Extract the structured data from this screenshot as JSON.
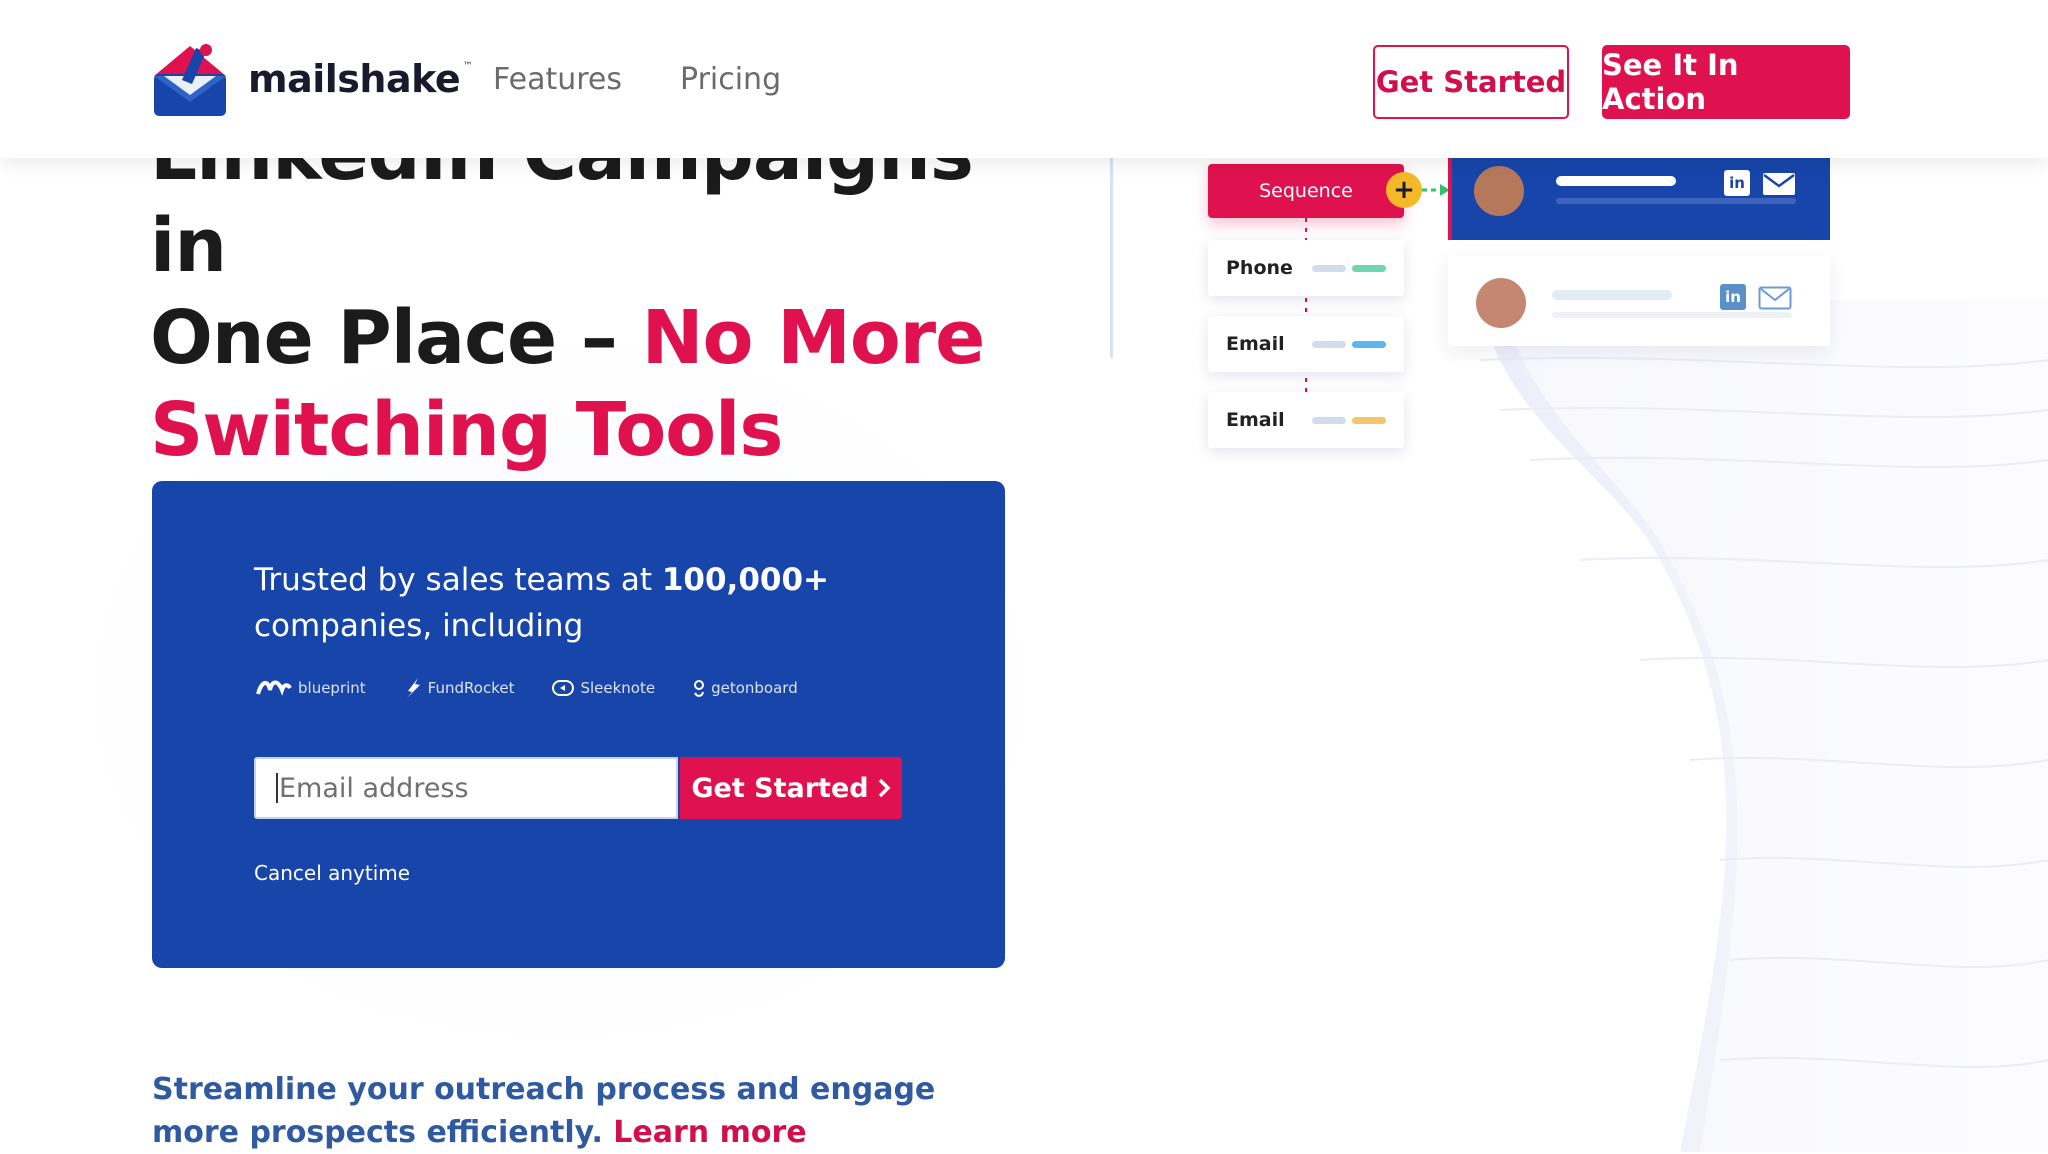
{
  "header": {
    "brand": "mailshake",
    "brand_tm": "™",
    "nav": [
      "Features",
      "Pricing"
    ],
    "cta_secondary": "Get Started",
    "cta_primary": "See It In Action"
  },
  "hero": {
    "headline_line1": "LinkedIn Campaigns in",
    "headline_line2_plain": "One Place – ",
    "headline_line2_accent": "No More",
    "headline_line3_accent": "Switching Tools"
  },
  "panel": {
    "trusted_prefix": "Trusted by sales teams at ",
    "trusted_bold": "100,000+",
    "trusted_suffix": " companies, including",
    "logos": [
      "blueprint",
      "FundRocket",
      "Sleeknote",
      "getonboard"
    ],
    "email_placeholder": "Email address",
    "button": "Get Started",
    "cancel": "Cancel anytime"
  },
  "bottom": {
    "text": "Streamline your outreach process and engage more prospects efficiently.",
    "link": "Learn more"
  },
  "illustration": {
    "sequence": "Sequence",
    "steps": [
      "Phone",
      "Email",
      "Email"
    ]
  },
  "colors": {
    "brand_pink": "#e0114f",
    "brand_blue": "#1745aa",
    "text_dark": "#1b1b1b",
    "link_blue": "#2f5aa0"
  }
}
